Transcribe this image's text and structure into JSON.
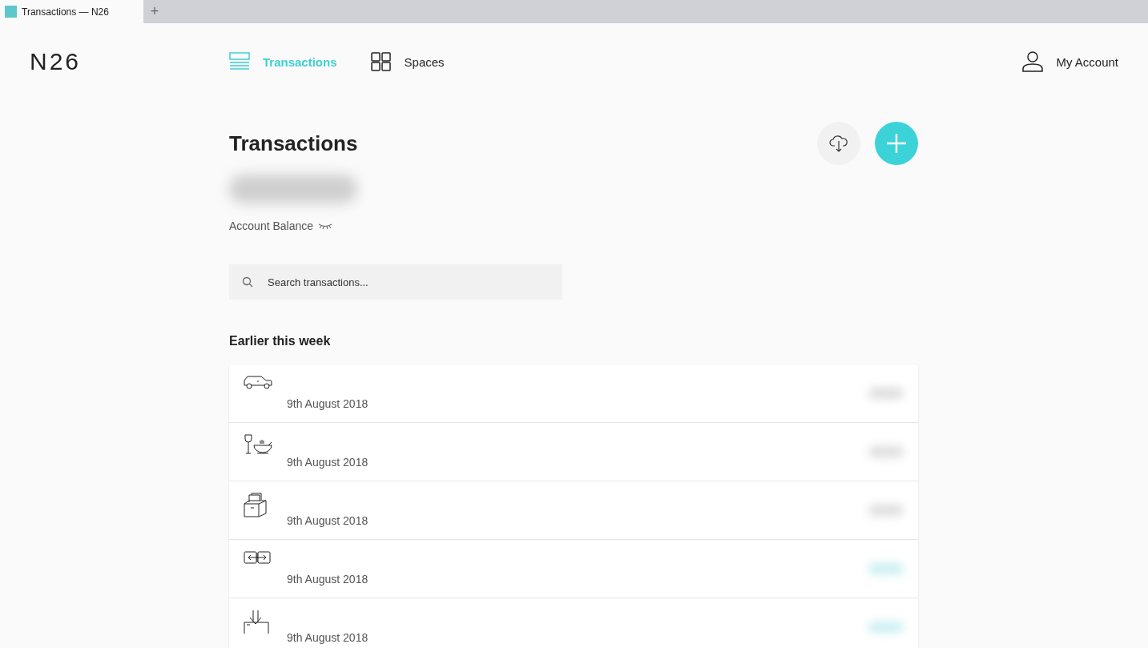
{
  "browser_tab": {
    "title": "Transactions — N26",
    "new_tab": "+"
  },
  "logo": "N26",
  "nav": [
    {
      "label": "Transactions",
      "selected": true
    },
    {
      "label": "Spaces",
      "selected": false
    }
  ],
  "account_link": "My Account",
  "page_title": "Transactions",
  "balance_label": "Account Balance",
  "balance_hidden": true,
  "search": {
    "placeholder": "Search transactions..."
  },
  "section_title": "Earlier this week",
  "transactions": [
    {
      "date": "9th August 2018",
      "kind": "outgoing"
    },
    {
      "date": "9th August 2018",
      "kind": "outgoing"
    },
    {
      "date": "9th August 2018",
      "kind": "outgoing"
    },
    {
      "date": "9th August 2018",
      "kind": "incoming"
    },
    {
      "date": "9th August 2018",
      "kind": "incoming"
    }
  ]
}
